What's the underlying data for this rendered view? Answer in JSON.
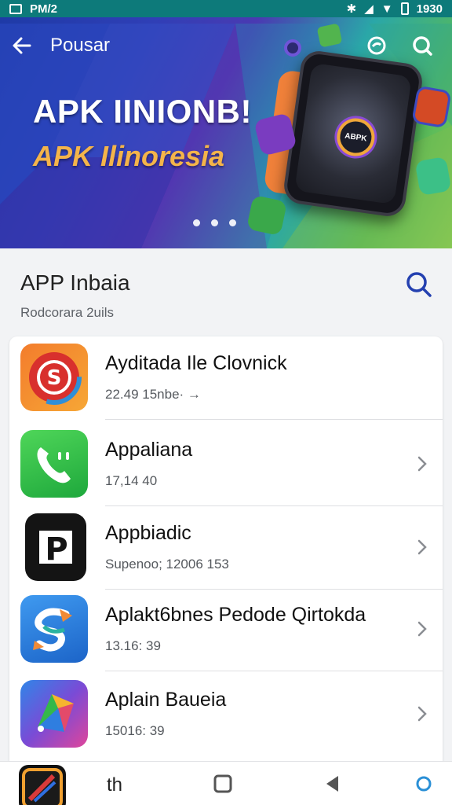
{
  "status_bar": {
    "time_left": "PM/2",
    "time_right": "1930"
  },
  "header": {
    "title": "Pousar"
  },
  "hero": {
    "title": "APK IINIONB!",
    "subtitle": "APK Ilinoresia",
    "phone_logo_text": "ABPK"
  },
  "section": {
    "title": "APP Inbaia",
    "subtitle": "Rodcorara 2uils"
  },
  "apps": [
    {
      "name": "Ayditada Ile Clovnick",
      "meta": "22.49 15nbe·  →",
      "icon": "orange-swirl-app-icon"
    },
    {
      "name": "Appaliana",
      "meta": "17,14 40",
      "icon": "green-phone-app-icon"
    },
    {
      "name": "Appbiadic",
      "meta": "Supenoo; 12006 153",
      "icon": "black-p-app-icon"
    },
    {
      "name": "Aplakt6bnes Pedode Qirtokda",
      "meta": "13.16: 39",
      "icon": "blue-s-app-icon"
    },
    {
      "name": "Aplain Baueia",
      "meta": "15016: 39",
      "icon": "gradient-arrow-app-icon"
    }
  ],
  "bottom_bar": {
    "label": "th"
  },
  "colors": {
    "accent": "#2440b0",
    "hero_subtitle": "#f4b44a",
    "status_bar": "#0d7a7a"
  }
}
